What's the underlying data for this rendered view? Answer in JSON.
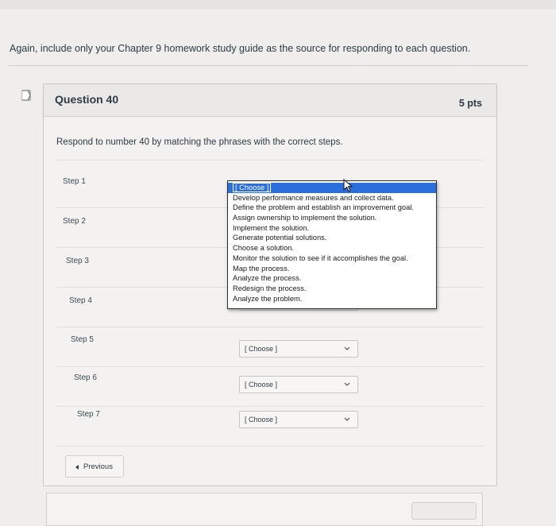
{
  "instructions": "Again, include only your Chapter 9 homework study guide as the source for responding to each question.",
  "question": {
    "title": "Question 40",
    "points": "5 pts",
    "prompt": "Respond to number 40 by matching the phrases with the correct steps.",
    "steps": [
      {
        "label": "Step 1",
        "selected": "[ Choose ]"
      },
      {
        "label": "Step 2",
        "selected": ""
      },
      {
        "label": "Step 3",
        "selected": ""
      },
      {
        "label": "Step 4",
        "selected": ""
      },
      {
        "label": "Step 5",
        "selected": "[ Choose ]"
      },
      {
        "label": "Step 6",
        "selected": "[ Choose ]"
      },
      {
        "label": "Step 7",
        "selected": "[ Choose ]"
      }
    ],
    "dropdown_options": [
      "[ Choose ]",
      "Develop performance measures and collect data.",
      "Define the problem and establish an improvement goal.",
      "Assign ownership to implement the solution.",
      "Implement the solution.",
      "Generate potential solutions.",
      "Choose a solution.",
      "Monitor the solution to see if it accomplishes the goal.",
      "Map the process.",
      "Analyze the process.",
      "Redesign the process.",
      "Analyze the problem."
    ]
  },
  "nav": {
    "previous_label": "Previous"
  },
  "colors": {
    "highlight": "#2a6fdb",
    "text": "#2d3b45"
  }
}
